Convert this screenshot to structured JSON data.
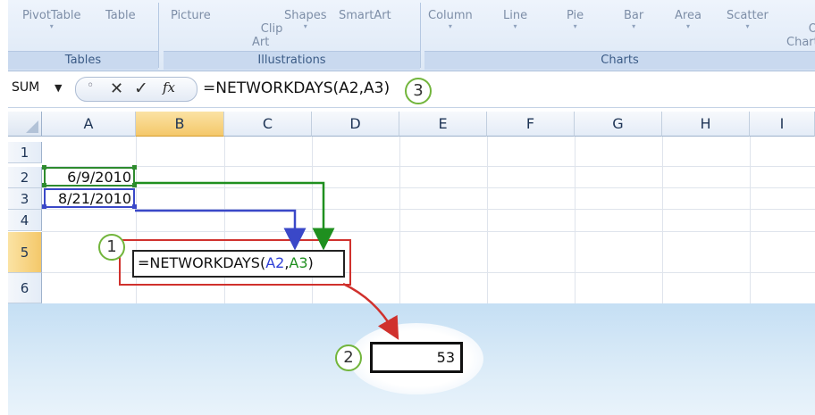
{
  "ribbon": {
    "groups": [
      {
        "label": "Tables",
        "buttons": [
          {
            "label": "PivotTable",
            "dropdown": true
          },
          {
            "label": "Table",
            "dropdown": false
          }
        ]
      },
      {
        "label": "Illustrations",
        "buttons": [
          {
            "label": "Picture",
            "dropdown": false
          },
          {
            "label": "Clip\nArt",
            "dropdown": false
          },
          {
            "label": "Shapes",
            "dropdown": true
          },
          {
            "label": "SmartArt",
            "dropdown": false
          }
        ]
      },
      {
        "label": "Charts",
        "buttons": [
          {
            "label": "Column",
            "dropdown": true
          },
          {
            "label": "Line",
            "dropdown": true
          },
          {
            "label": "Pie",
            "dropdown": true
          },
          {
            "label": "Bar",
            "dropdown": true
          },
          {
            "label": "Area",
            "dropdown": true
          },
          {
            "label": "Scatter",
            "dropdown": true
          },
          {
            "label": "Othe\nChart",
            "dropdown": false
          }
        ]
      }
    ]
  },
  "formula_bar": {
    "name_box": "SUM",
    "ellipsis": "◦",
    "cancel": "✕",
    "enter": "✓",
    "fx": "fx",
    "formula": "=NETWORKDAYS(A2,A3)"
  },
  "sheet": {
    "columns": [
      "A",
      "B",
      "C",
      "D",
      "E",
      "F",
      "G",
      "H",
      "I"
    ],
    "rows": [
      "1",
      "2",
      "3",
      "4",
      "5",
      "6"
    ],
    "selected_column": "B",
    "selected_row": "5",
    "cells": {
      "A2": "6/9/2010",
      "A3": "8/21/2010"
    }
  },
  "edit_cell": {
    "prefix": "=NETWORKDAYS(",
    "ref1": "A2",
    "comma": ",",
    "ref2": "A3",
    "suffix": ")"
  },
  "result": {
    "value": "53"
  },
  "callouts": [
    "1",
    "2",
    "3"
  ],
  "colors": {
    "ref_a2": "#2e3fd6",
    "ref_a3": "#1f8f1f",
    "highlight": "#d0312d",
    "callout_ring": "#72b53c"
  }
}
